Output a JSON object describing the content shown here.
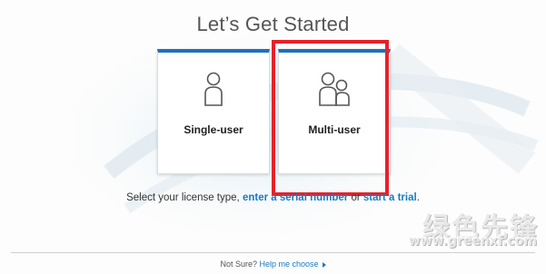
{
  "page": {
    "title": "Let’s Get Started"
  },
  "cards": [
    {
      "label": "Single-user",
      "icon": "single-user-icon"
    },
    {
      "label": "Multi-user",
      "icon": "multi-user-icon"
    }
  ],
  "instruction": {
    "prefix": "Select your license type, ",
    "link_serial": "enter a serial number",
    "middle": " or ",
    "link_trial": "start a trial",
    "suffix": "."
  },
  "footer": {
    "prefix": "Not Sure?",
    "link": "Help me choose"
  },
  "watermark": {
    "cn": "绿色先锋",
    "url": "www.greenxf.com"
  },
  "colors": {
    "accent": "#1f6fc1",
    "link": "#1a7bc4",
    "highlight": "#e8202a"
  }
}
